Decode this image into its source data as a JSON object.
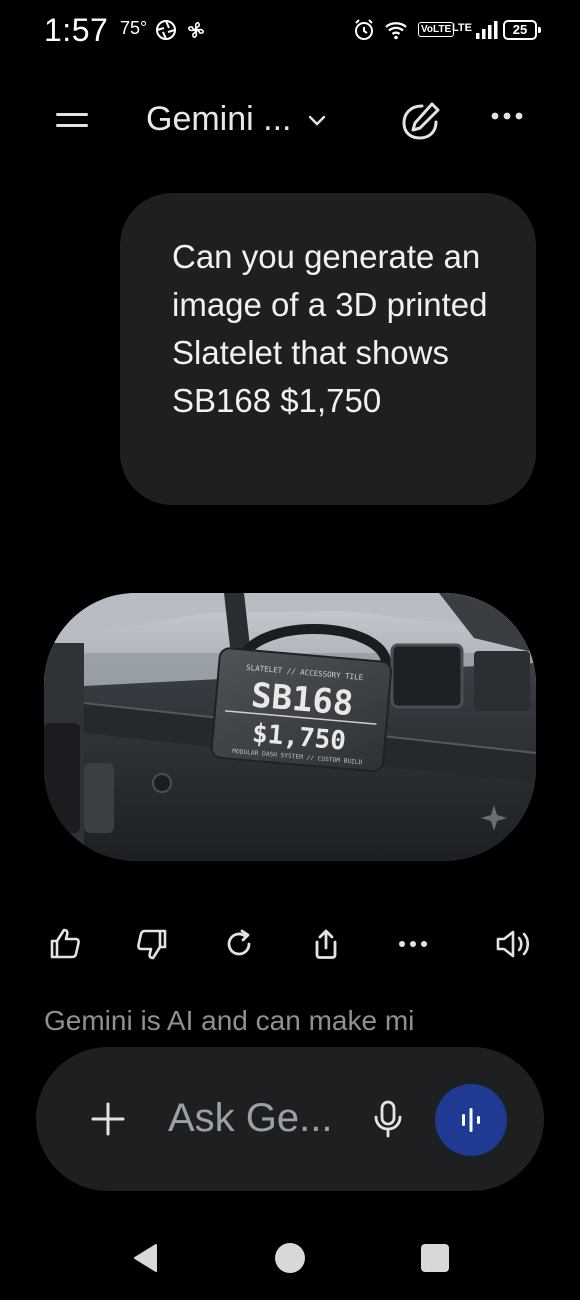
{
  "status_bar": {
    "time": "1:57",
    "temperature": "75°",
    "volte": "VoLTE",
    "lte": "LTE",
    "battery": "25",
    "icons": [
      "camera-aperture-icon",
      "fan-icon",
      "alarm-icon",
      "wifi-icon",
      "signal-icon",
      "battery-icon"
    ]
  },
  "app_bar": {
    "title": "Gemini ...",
    "icons": [
      "menu-icon",
      "chevron-down-icon",
      "new-chat-icon",
      "more-icon"
    ]
  },
  "conversation": {
    "user_message": "Can you generate an image of a 3D printed Slatelet that shows SB168 $1,750",
    "image": {
      "tile_header": "SLATELET // ACCESSORY TILE",
      "tile_main": "SB168",
      "tile_price": "$1,750",
      "tile_footer": "MODULAR DASH SYSTEM // CUSTOM BUILD"
    }
  },
  "actions": {
    "icons": [
      "thumbs-up-icon",
      "thumbs-down-icon",
      "regenerate-icon",
      "share-icon",
      "more-icon",
      "read-aloud-icon"
    ]
  },
  "disclaimer": "Gemini is AI and can make mi",
  "input_bar": {
    "placeholder": "Ask Ge..."
  },
  "colors": {
    "background": "#000000",
    "bubble": "#1e1f20",
    "live_button": "#1f3a93",
    "muted_text": "#8e918f"
  },
  "nav_bar": {
    "icons": [
      "back-icon",
      "home-icon",
      "recents-icon"
    ]
  }
}
